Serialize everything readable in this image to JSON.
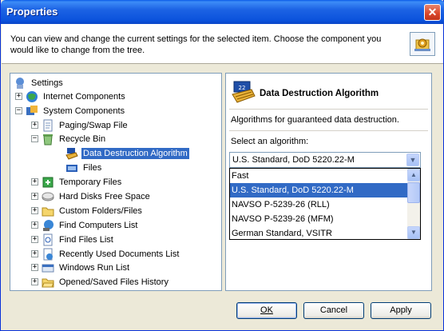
{
  "window": {
    "title": "Properties",
    "close": "✕"
  },
  "header": {
    "text": "You can view and change the current settings for the selected item. Choose the component you would like to change from the tree."
  },
  "tree": {
    "nodes": [
      {
        "label": "Settings",
        "expander": "",
        "icon": "settings-icon"
      },
      {
        "label": "Internet Components",
        "expander": "+",
        "icon": "globe-icon"
      },
      {
        "label": "System Components",
        "expander": "−",
        "icon": "system-icon"
      },
      {
        "label": "Paging/Swap File",
        "expander": "+",
        "icon": "page-icon"
      },
      {
        "label": "Recycle Bin",
        "expander": "−",
        "icon": "recycle-bin-icon"
      },
      {
        "label": "Data Destruction Algorithm",
        "expander": "",
        "icon": "shredder-icon",
        "selected": true
      },
      {
        "label": "Files",
        "expander": "",
        "icon": "files-icon"
      },
      {
        "label": "Temporary Files",
        "expander": "+",
        "icon": "temp-files-icon"
      },
      {
        "label": "Hard Disks Free Space",
        "expander": "+",
        "icon": "hard-disk-icon"
      },
      {
        "label": "Custom Folders/Files",
        "expander": "+",
        "icon": "folder-icon"
      },
      {
        "label": "Find Computers List",
        "expander": "+",
        "icon": "find-computer-icon"
      },
      {
        "label": "Find Files List",
        "expander": "+",
        "icon": "find-files-icon"
      },
      {
        "label": "Recently Used Documents List",
        "expander": "+",
        "icon": "recent-docs-icon"
      },
      {
        "label": "Windows Run List",
        "expander": "+",
        "icon": "run-icon"
      },
      {
        "label": "Opened/Saved Files History",
        "expander": "+",
        "icon": "opened-folder-icon"
      }
    ]
  },
  "panel": {
    "title": "Data Destruction Algorithm",
    "description": "Algorithms for guaranteed data destruction.",
    "select_label": "Select an algorithm:",
    "selected": "U.S. Standard, DoD 5220.22-M",
    "options": [
      "Fast",
      "U.S. Standard, DoD 5220.22-M",
      "NAVSO P-5239-26 (RLL)",
      "NAVSO P-5239-26 (MFM)",
      "German Standard, VSITR"
    ],
    "selected_index": 1
  },
  "buttons": {
    "ok": "OK",
    "cancel": "Cancel",
    "apply": "Apply"
  },
  "colors": {
    "title_bar": "#0b52dc",
    "selection": "#316ac5",
    "dialog_bg": "#ece9d8"
  }
}
